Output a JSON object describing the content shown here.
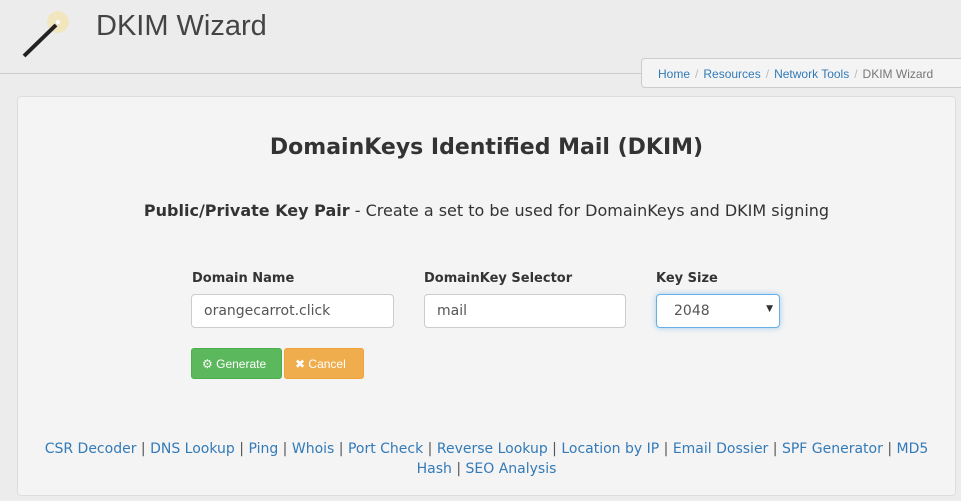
{
  "header": {
    "title": "DKIM Wizard"
  },
  "breadcrumb": [
    "Home",
    "Resources",
    "Network Tools",
    "DKIM Wizard"
  ],
  "main": {
    "heading": "DomainKeys Identified Mail (DKIM)",
    "subtitle_bold": "Public/Private Key Pair",
    "subtitle_rest": " - Create a set to be used for DomainKeys and DKIM signing",
    "domain_label": "Domain Name",
    "domain_value": "orangecarrot.click",
    "selector_label": "DomainKey Selector",
    "selector_value": "mail",
    "keysize_label": "Key Size",
    "keysize_value": "2048",
    "generate": "Generate",
    "cancel": "Cancel"
  },
  "colors": {
    "generate": "#5cb85c",
    "cancel": "#f0ad4e",
    "link": "#337ab7"
  },
  "footer_links": [
    "CSR Decoder",
    "DNS Lookup",
    "Ping",
    "Whois",
    "Port Check",
    "Reverse Lookup",
    "Location by IP",
    "Email Dossier",
    "SPF Generator",
    "MD5 Hash",
    "SEO Analysis"
  ]
}
